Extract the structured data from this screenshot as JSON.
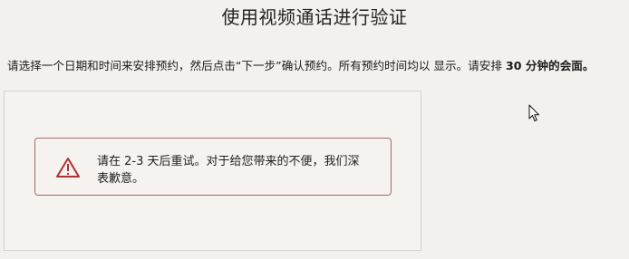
{
  "header": {
    "title": "使用视频通话进行验证"
  },
  "instructions": {
    "part1": "请选择一个日期和时间来安排预约，然后点击“下一步”确认预约。所有预约时间均以 显示。请安排 ",
    "duration_bold": "30 分钟的会面。"
  },
  "alert": {
    "icon": "warning-triangle-icon",
    "message": "请在 2-3 天后重试。对于给您带来的不便，我们深表歉意。"
  },
  "colors": {
    "background": "#f2f1ee",
    "alert_border": "#a76a6a",
    "alert_icon": "#b03030"
  }
}
